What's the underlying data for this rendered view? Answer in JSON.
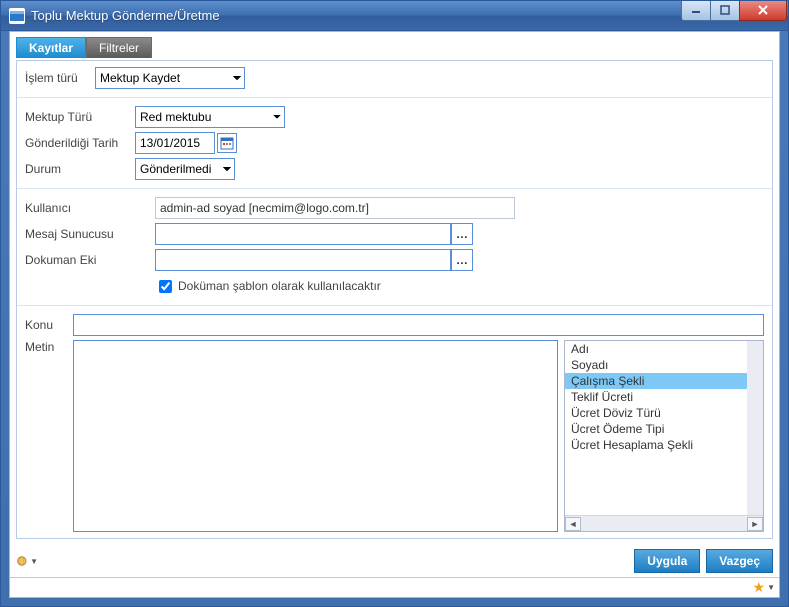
{
  "window": {
    "title": "Toplu Mektup Gönderme/Üretme"
  },
  "tabs": {
    "records": "Kayıtlar",
    "filters": "Filtreler"
  },
  "labels": {
    "islem_turu": "İşlem türü",
    "mektup_turu": "Mektup Türü",
    "gonder_tarih": "Gönderildiği Tarih",
    "durum": "Durum",
    "kullanici": "Kullanıcı",
    "mesaj_sunucusu": "Mesaj Sunucusu",
    "dokuman_eki": "Dokuman Eki",
    "konu": "Konu",
    "metin": "Metin",
    "sablon_checkbox": "Doküman şablon olarak kullanılacaktır"
  },
  "values": {
    "islem_turu": "Mektup Kaydet",
    "mektup_turu": "Red mektubu",
    "gonder_tarih": "13/01/2015",
    "durum": "Gönderilmedi",
    "kullanici": "admin-ad soyad [necmim@logo.com.tr]",
    "mesaj_sunucusu": "",
    "dokuman_eki": "",
    "sablon_checked": true,
    "konu": "",
    "metin": ""
  },
  "fieldlist_items": [
    "Adı",
    "Soyadı",
    "Çalışma Şekli",
    "Teklif Ücreti",
    "Ücret Döviz Türü",
    "Ücret Ödeme Tipi",
    "Ücret Hesaplama Şekli"
  ],
  "fieldlist_selected_index": 2,
  "buttons": {
    "apply": "Uygula",
    "cancel": "Vazgeç"
  }
}
